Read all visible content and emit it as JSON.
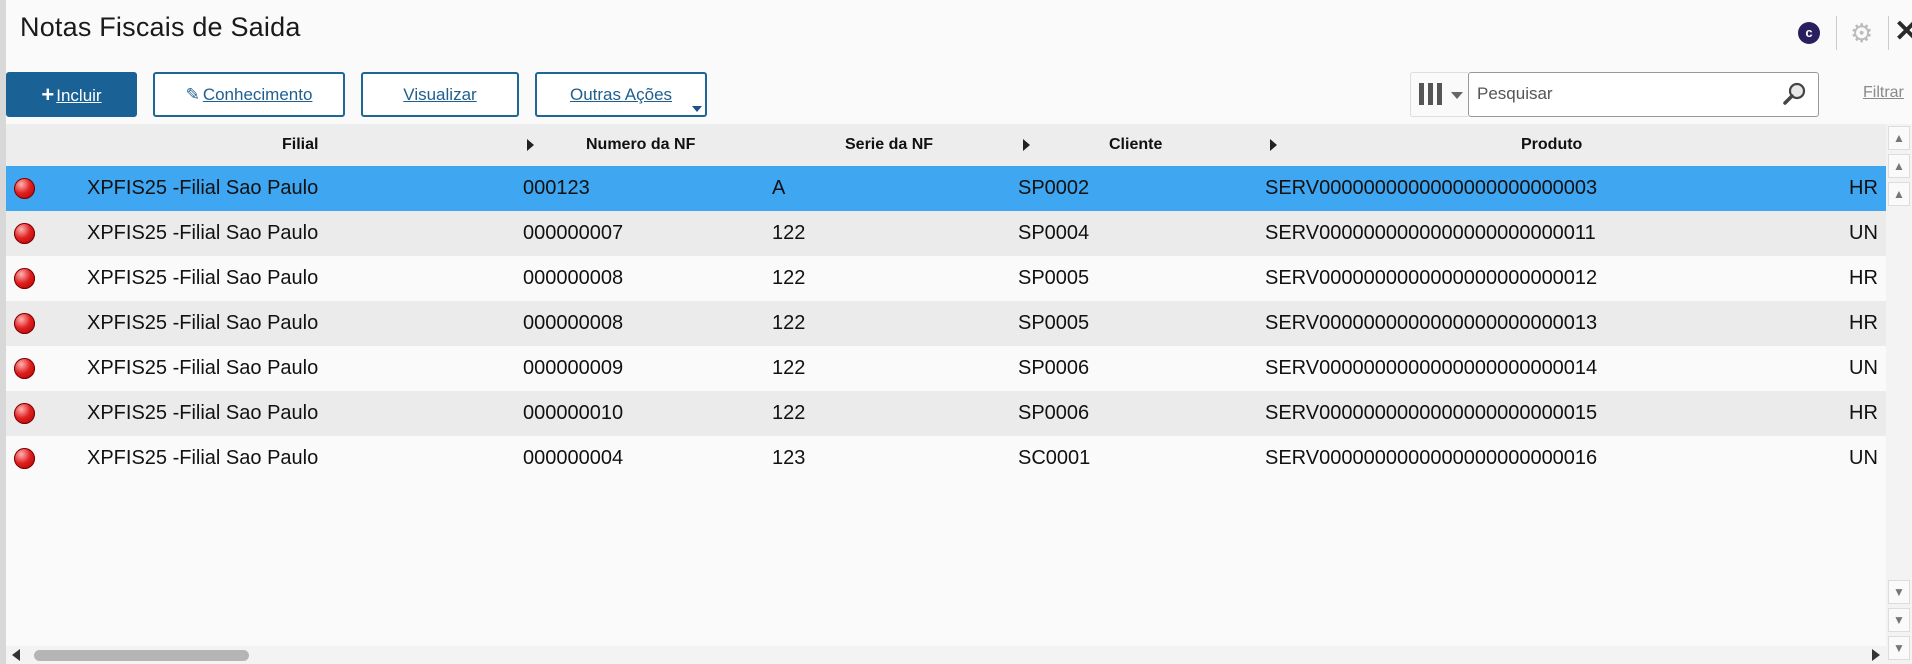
{
  "window": {
    "title": "Notas Fiscais de Saida",
    "logo_letter": "c"
  },
  "toolbar": {
    "incluir_label": "Incluir",
    "conhecimento_label": "Conhecimento",
    "visualizar_label": "Visualizar",
    "outras_acoes_label": "Outras Ações",
    "search_placeholder": "Pesquisar",
    "filtrar_label": "Filtrar"
  },
  "table": {
    "columns": [
      "Filial",
      "Numero da NF",
      "Serie da NF",
      "Cliente",
      "Produto"
    ],
    "rows": [
      {
        "status": "red",
        "filial": "XPFIS25 -Filial Sao Paulo",
        "numero": "000123",
        "serie": "A",
        "cliente": "SP0002",
        "produto": "SERV0000000000000000000000003",
        "unidade": "HR",
        "selected": true
      },
      {
        "status": "red",
        "filial": "XPFIS25 -Filial Sao Paulo",
        "numero": "000000007",
        "serie": "122",
        "cliente": "SP0004",
        "produto": "SERV0000000000000000000000011",
        "unidade": "UN"
      },
      {
        "status": "red",
        "filial": "XPFIS25 -Filial Sao Paulo",
        "numero": "000000008",
        "serie": "122",
        "cliente": "SP0005",
        "produto": "SERV0000000000000000000000012",
        "unidade": "HR"
      },
      {
        "status": "red",
        "filial": "XPFIS25 -Filial Sao Paulo",
        "numero": "000000008",
        "serie": "122",
        "cliente": "SP0005",
        "produto": "SERV0000000000000000000000013",
        "unidade": "HR"
      },
      {
        "status": "red",
        "filial": "XPFIS25 -Filial Sao Paulo",
        "numero": "000000009",
        "serie": "122",
        "cliente": "SP0006",
        "produto": "SERV0000000000000000000000014",
        "unidade": "UN"
      },
      {
        "status": "red",
        "filial": "XPFIS25 -Filial Sao Paulo",
        "numero": "000000010",
        "serie": "122",
        "cliente": "SP0006",
        "produto": "SERV0000000000000000000000015",
        "unidade": "HR"
      },
      {
        "status": "red",
        "filial": "XPFIS25 -Filial Sao Paulo",
        "numero": "000000004",
        "serie": "123",
        "cliente": "SC0001",
        "produto": "SERV0000000000000000000000016",
        "unidade": "UN"
      }
    ]
  },
  "colors": {
    "primary": "#1a6295",
    "selected_row": "#3fa6f2",
    "status_red": "#e02020"
  }
}
